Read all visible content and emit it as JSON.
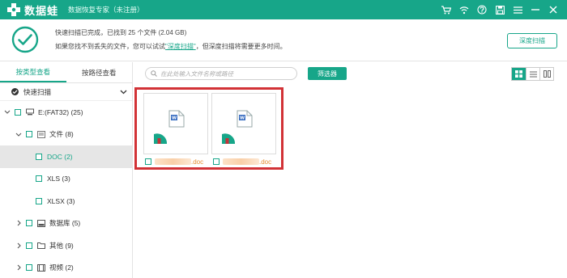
{
  "app": {
    "brand": "数据蛙",
    "subtitle": "数据恢复专家（未注册）",
    "brand_color": "#17a689",
    "controls": [
      "cart-icon",
      "wifi-icon",
      "help-icon",
      "save-icon",
      "menu-icon",
      "minimize-icon",
      "close-icon"
    ]
  },
  "info": {
    "line1": "快速扫描已完成，已找到 25 个文件 (2.04 GB)",
    "line2_prefix": "如果您找不到丢失的文件，您可以试试",
    "line2_link": "\"深度扫描\"",
    "line2_suffix": "，但深度扫描将需要更多时间。",
    "deep_scan_button": "深度扫描"
  },
  "sidebar": {
    "tabs": [
      {
        "label": "按类型查看",
        "active": true
      },
      {
        "label": "按路径查看",
        "active": false
      }
    ],
    "scan_mode": "快速扫描",
    "tree": [
      {
        "label": "E:(FAT32) (25)",
        "level": 0,
        "expanded": true,
        "icon": "drive-icon"
      },
      {
        "label": "文件 (8)",
        "level": 1,
        "expanded": true,
        "icon": "document-icon"
      },
      {
        "label": "DOC (2)",
        "level": 2,
        "selected": true
      },
      {
        "label": "XLS (3)",
        "level": 2
      },
      {
        "label": "XLSX (3)",
        "level": 2
      },
      {
        "label": "数据库 (5)",
        "level": 1,
        "expanded": false,
        "icon": "database-icon"
      },
      {
        "label": "其他 (9)",
        "level": 1,
        "expanded": false,
        "icon": "folder-icon"
      },
      {
        "label": "视频 (2)",
        "level": 1,
        "expanded": false,
        "icon": "video-icon"
      }
    ]
  },
  "toolbar": {
    "search_placeholder": "在此处输入文件名称或路径",
    "filter_button": "筛选器",
    "views": [
      "grid-view-icon",
      "list-view-icon",
      "detail-view-icon"
    ],
    "active_view": "grid-view-icon"
  },
  "files": [
    {
      "ext": ".doc"
    },
    {
      "ext": ".doc"
    }
  ],
  "highlight_color": "#d23236"
}
